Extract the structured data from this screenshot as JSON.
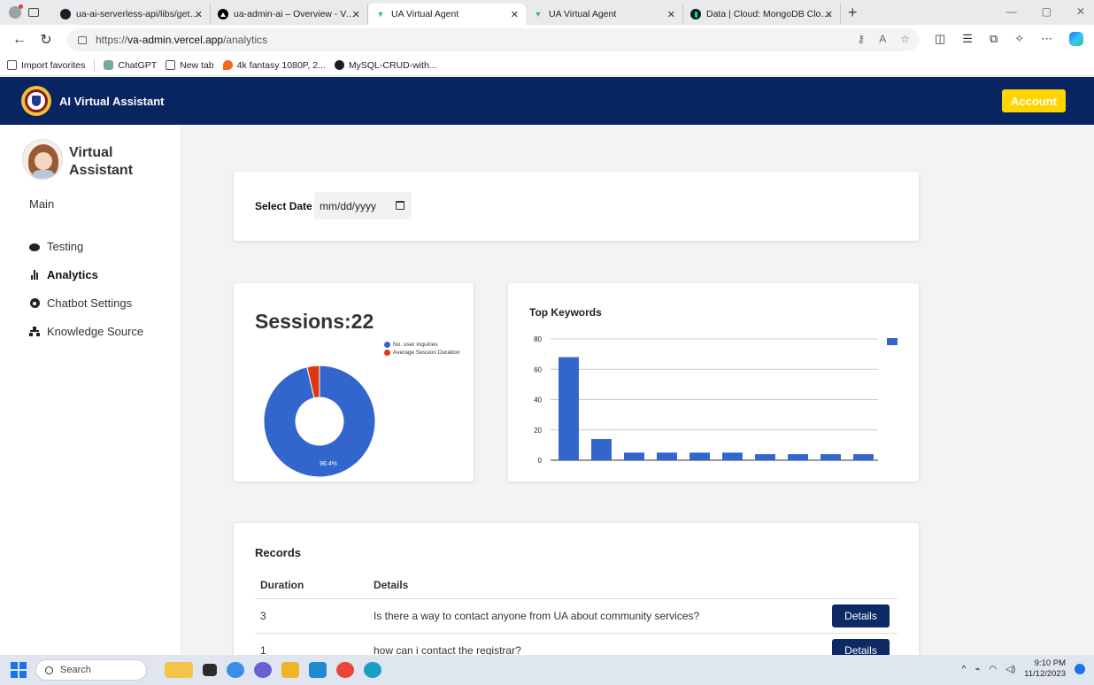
{
  "browser": {
    "tabs": [
      {
        "title": "ua-ai-serverless-api/libs/getLibs",
        "favicon": "github-icon"
      },
      {
        "title": "ua-admin-ai – Overview - Vercel",
        "favicon": "vercel-icon"
      },
      {
        "title": "UA Virtual Agent",
        "favicon": "vue-icon",
        "active": true
      },
      {
        "title": "UA Virtual Agent",
        "favicon": "vue-icon"
      },
      {
        "title": "Data | Cloud: MongoDB Cloud",
        "favicon": "mongodb-icon"
      }
    ],
    "url_scheme": "https://",
    "url_host": "va-admin.vercel.app",
    "url_path": "/analytics",
    "favorites": [
      {
        "label": "Import favorites"
      },
      {
        "label": "ChatGPT"
      },
      {
        "label": "New tab"
      },
      {
        "label": "4k fantasy 1080P, 2..."
      },
      {
        "label": "MySQL-CRUD-with..."
      }
    ]
  },
  "header": {
    "title": "AI Virtual Assistant",
    "account_label": "Account"
  },
  "sidebar": {
    "title": "Virtual Assistant",
    "section": "Main",
    "items": [
      {
        "label": "Testing",
        "icon": "chat-bubble-icon"
      },
      {
        "label": "Analytics",
        "icon": "bar-chart-icon",
        "active": true
      },
      {
        "label": "Chatbot Settings",
        "icon": "gear-icon"
      },
      {
        "label": "Knowledge Source",
        "icon": "sitemap-icon"
      }
    ]
  },
  "date_filter": {
    "label": "Select Date",
    "placeholder": "mm/dd/yyyy"
  },
  "sessions": {
    "title": "Sessions:22"
  },
  "keywords": {
    "title": "Top Keywords"
  },
  "chart_data": [
    {
      "type": "pie",
      "variant": "donut",
      "labels": [
        "No. user inquiries",
        "Average Session Duration"
      ],
      "values": [
        96.4,
        3.6
      ],
      "colors": [
        "#3366cc",
        "#dc3912"
      ],
      "data_labels": [
        "96.4%"
      ],
      "legend": "right"
    },
    {
      "type": "bar",
      "title": "Top Keywords",
      "categories": [
        "",
        "",
        "",
        "",
        "",
        "",
        "",
        "",
        "",
        ""
      ],
      "values": [
        68,
        14,
        5,
        5,
        5,
        5,
        4,
        4,
        4,
        4
      ],
      "ylim": [
        0,
        80
      ],
      "yticks": [
        0,
        20,
        40,
        60,
        80
      ],
      "grid": true,
      "legend": "top-right",
      "color": "#3366cc"
    }
  ],
  "records": {
    "title": "Records",
    "columns": [
      "Duration",
      "Details"
    ],
    "rows": [
      {
        "duration": "3",
        "details": "Is there a way to contact anyone from UA about community services?",
        "button": "Details"
      },
      {
        "duration": "1",
        "details": "how can i contact the registrar?",
        "button": "Details"
      }
    ]
  },
  "taskbar": {
    "search_label": "Search",
    "time": "9:10 PM",
    "date": "11/12/2023"
  }
}
